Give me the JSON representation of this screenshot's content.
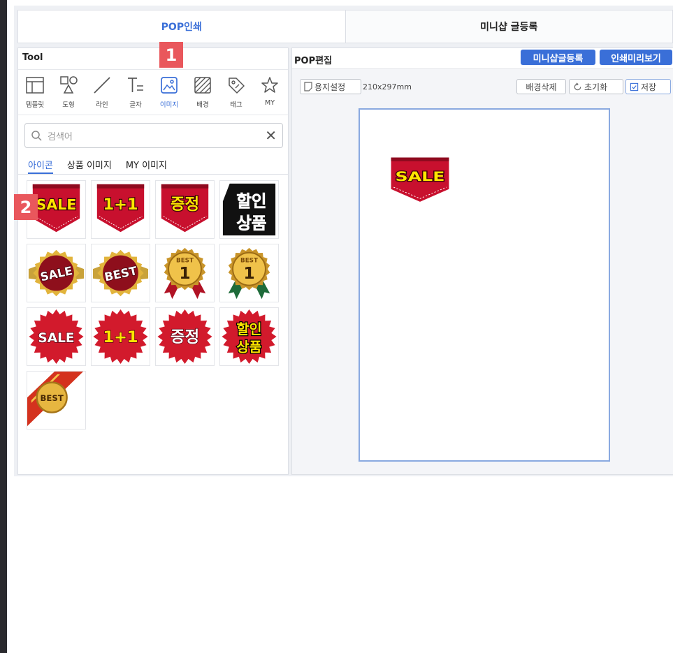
{
  "top_tabs": [
    "POP인쇄",
    "미니샵 글등록"
  ],
  "tool_panel": {
    "title": "Tool",
    "tools": [
      {
        "icon": "template-icon",
        "label": "템플릿"
      },
      {
        "icon": "shape-icon",
        "label": "도형"
      },
      {
        "icon": "line-icon",
        "label": "라인"
      },
      {
        "icon": "text-icon",
        "label": "글자"
      },
      {
        "icon": "image-icon",
        "label": "이미지"
      },
      {
        "icon": "background-icon",
        "label": "배경"
      },
      {
        "icon": "tag-icon",
        "label": "태그"
      },
      {
        "icon": "star-icon",
        "label": "MY"
      }
    ],
    "active_tool": "이미지",
    "search_placeholder": "검색어",
    "subtabs": [
      "아이콘",
      "상품 이미지",
      "MY 이미지"
    ],
    "active_subtab": "아이콘"
  },
  "icons": [
    {
      "type": "pennant",
      "text": "SALE",
      "text_color": "#ffe600"
    },
    {
      "type": "pennant",
      "text": "1+1",
      "text_color": "#ffe600"
    },
    {
      "type": "pennant",
      "text": "증정",
      "text_color": "#ffe600"
    },
    {
      "type": "block",
      "text1": "할인",
      "text2": "상품"
    },
    {
      "type": "seal",
      "text": "SALE"
    },
    {
      "type": "seal",
      "text": "BEST"
    },
    {
      "type": "medal",
      "ribbon": "red",
      "text": "BEST",
      "number": "1"
    },
    {
      "type": "medal",
      "ribbon": "green",
      "text": "BEST",
      "number": "1"
    },
    {
      "type": "burst",
      "text": "SALE",
      "text_color": "#ffffff"
    },
    {
      "type": "burst",
      "text": "1+1",
      "text_color": "#ffe600"
    },
    {
      "type": "burst",
      "text": "증정",
      "text_color": "#ffffff"
    },
    {
      "type": "burst2",
      "text1": "할인",
      "text2": "상품"
    },
    {
      "type": "corner",
      "text": "BEST"
    }
  ],
  "editor": {
    "title": "POP편집",
    "buttons": {
      "mini_shop": "미니샵글등록",
      "preview": "인쇄미리보기"
    },
    "paper_setting": "용지설정",
    "paper_size": "210x297mm",
    "delete_bg": "배경삭제",
    "reset": "초기화",
    "save": "저장",
    "canvas_item": {
      "type": "pennant",
      "text": "SALE",
      "text_color": "#ffe600"
    }
  },
  "badges": [
    "1",
    "2"
  ],
  "colors": {
    "accent": "#3a6fd8",
    "badge": "#e9575c",
    "pennant": "#c8102e"
  }
}
